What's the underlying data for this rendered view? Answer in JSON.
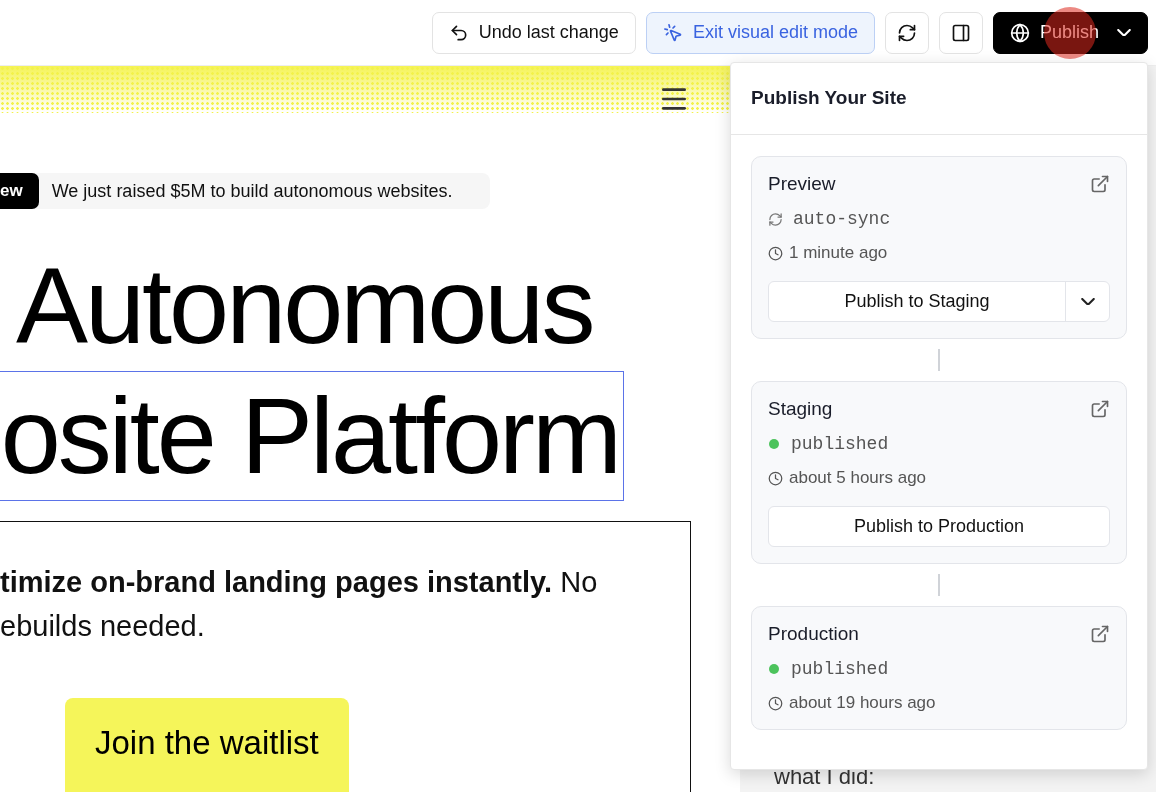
{
  "toolbar": {
    "buttons": [
      {
        "kind": "undo",
        "label": "Undo last change"
      },
      {
        "kind": "edit",
        "label": "Exit visual edit mode"
      },
      {
        "kind": "refresh"
      },
      {
        "kind": "panel"
      },
      {
        "kind": "publish",
        "label": "Publish"
      }
    ]
  },
  "site": {
    "badge": "ew",
    "announcement": "We just raised $5M to build autonomous websites.",
    "heading_lines": [
      {
        "text": "Autonomous",
        "selected": false
      },
      {
        "text": "osite Platform",
        "selected": true
      }
    ],
    "subtitle_lines": [
      "**timize on-brand landing pages instantly.** No",
      "ebuilds needed."
    ],
    "cta": "Join the waitlist"
  },
  "chat": {
    "text": "what I did:"
  },
  "publish_panel": {
    "title": "Publish Your Site",
    "environments": [
      {
        "name": "Preview",
        "status": {
          "kind": "sync",
          "text": "auto-sync"
        },
        "time": "1 minute ago",
        "action": {
          "label": "Publish to Staging",
          "menu": true
        }
      },
      {
        "name": "Staging",
        "status": {
          "kind": "dot",
          "text": "published"
        },
        "time": "about 5 hours ago",
        "action": {
          "label": "Publish to Production",
          "menu": false
        }
      },
      {
        "name": "Production",
        "status": {
          "kind": "dot",
          "text": "published"
        },
        "time": "about 19 hours ago"
      }
    ]
  }
}
